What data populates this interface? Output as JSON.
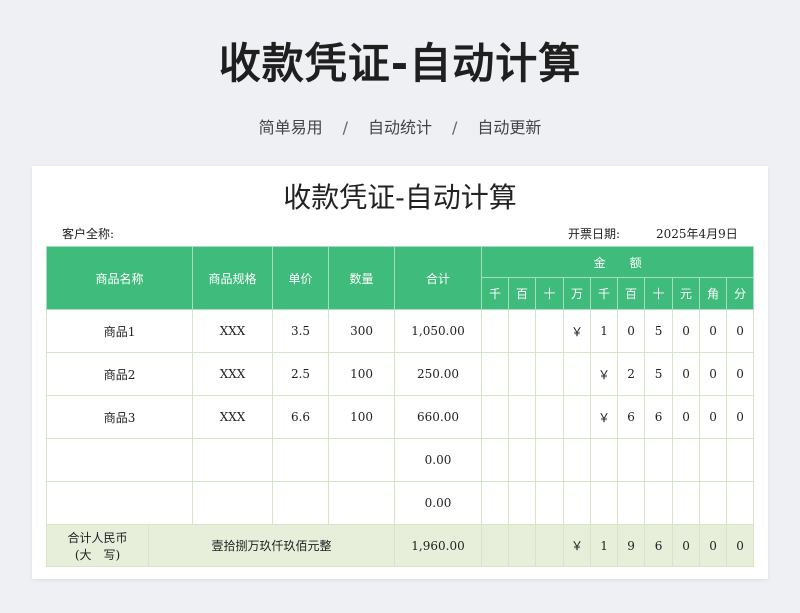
{
  "hero": {
    "title": "收款凭证-自动计算",
    "tags": [
      "简单易用",
      "自动统计",
      "自动更新"
    ],
    "separator": "/"
  },
  "voucher": {
    "title": "收款凭证-自动计算",
    "customer_label": "客户全称:",
    "date_label": "开票日期:",
    "date_value": "2025年4月9日",
    "headers": {
      "name": "商品名称",
      "spec": "商品规格",
      "price": "单价",
      "qty": "数量",
      "subtotal": "合计",
      "amount": "金　　额",
      "digit_units": [
        "千",
        "百",
        "十",
        "万",
        "千",
        "百",
        "十",
        "元",
        "角",
        "分"
      ]
    },
    "rows": [
      {
        "name": "商品1",
        "spec": "XXX",
        "price": "3.5",
        "qty": "300",
        "subtotal": "1,050.00",
        "digits": [
          "",
          "",
          "",
          "￥",
          "1",
          "0",
          "5",
          "0",
          "0",
          "0"
        ]
      },
      {
        "name": "商品2",
        "spec": "XXX",
        "price": "2.5",
        "qty": "100",
        "subtotal": "250.00",
        "digits": [
          "",
          "",
          "",
          "",
          "￥",
          "2",
          "5",
          "0",
          "0",
          "0"
        ]
      },
      {
        "name": "商品3",
        "spec": "XXX",
        "price": "6.6",
        "qty": "100",
        "subtotal": "660.00",
        "digits": [
          "",
          "",
          "",
          "",
          "￥",
          "6",
          "6",
          "0",
          "0",
          "0"
        ]
      },
      {
        "name": "",
        "spec": "",
        "price": "",
        "qty": "",
        "subtotal": "0.00",
        "digits": [
          "",
          "",
          "",
          "",
          "",
          "",
          "",
          "",
          "",
          ""
        ]
      },
      {
        "name": "",
        "spec": "",
        "price": "",
        "qty": "",
        "subtotal": "0.00",
        "digits": [
          "",
          "",
          "",
          "",
          "",
          "",
          "",
          "",
          "",
          ""
        ]
      }
    ],
    "total": {
      "label_line1": "合计人民币",
      "label_line2": "(大　写)",
      "in_words": "壹拾捌万玖仟玖佰元整",
      "subtotal": "1,960.00",
      "digits": [
        "",
        "",
        "",
        "￥",
        "1",
        "9",
        "6",
        "0",
        "0",
        "0"
      ]
    }
  },
  "colors": {
    "header_green": "#3fbb7b",
    "total_row_bg": "#e7efdb",
    "grid_line": "#d5e6c6"
  }
}
